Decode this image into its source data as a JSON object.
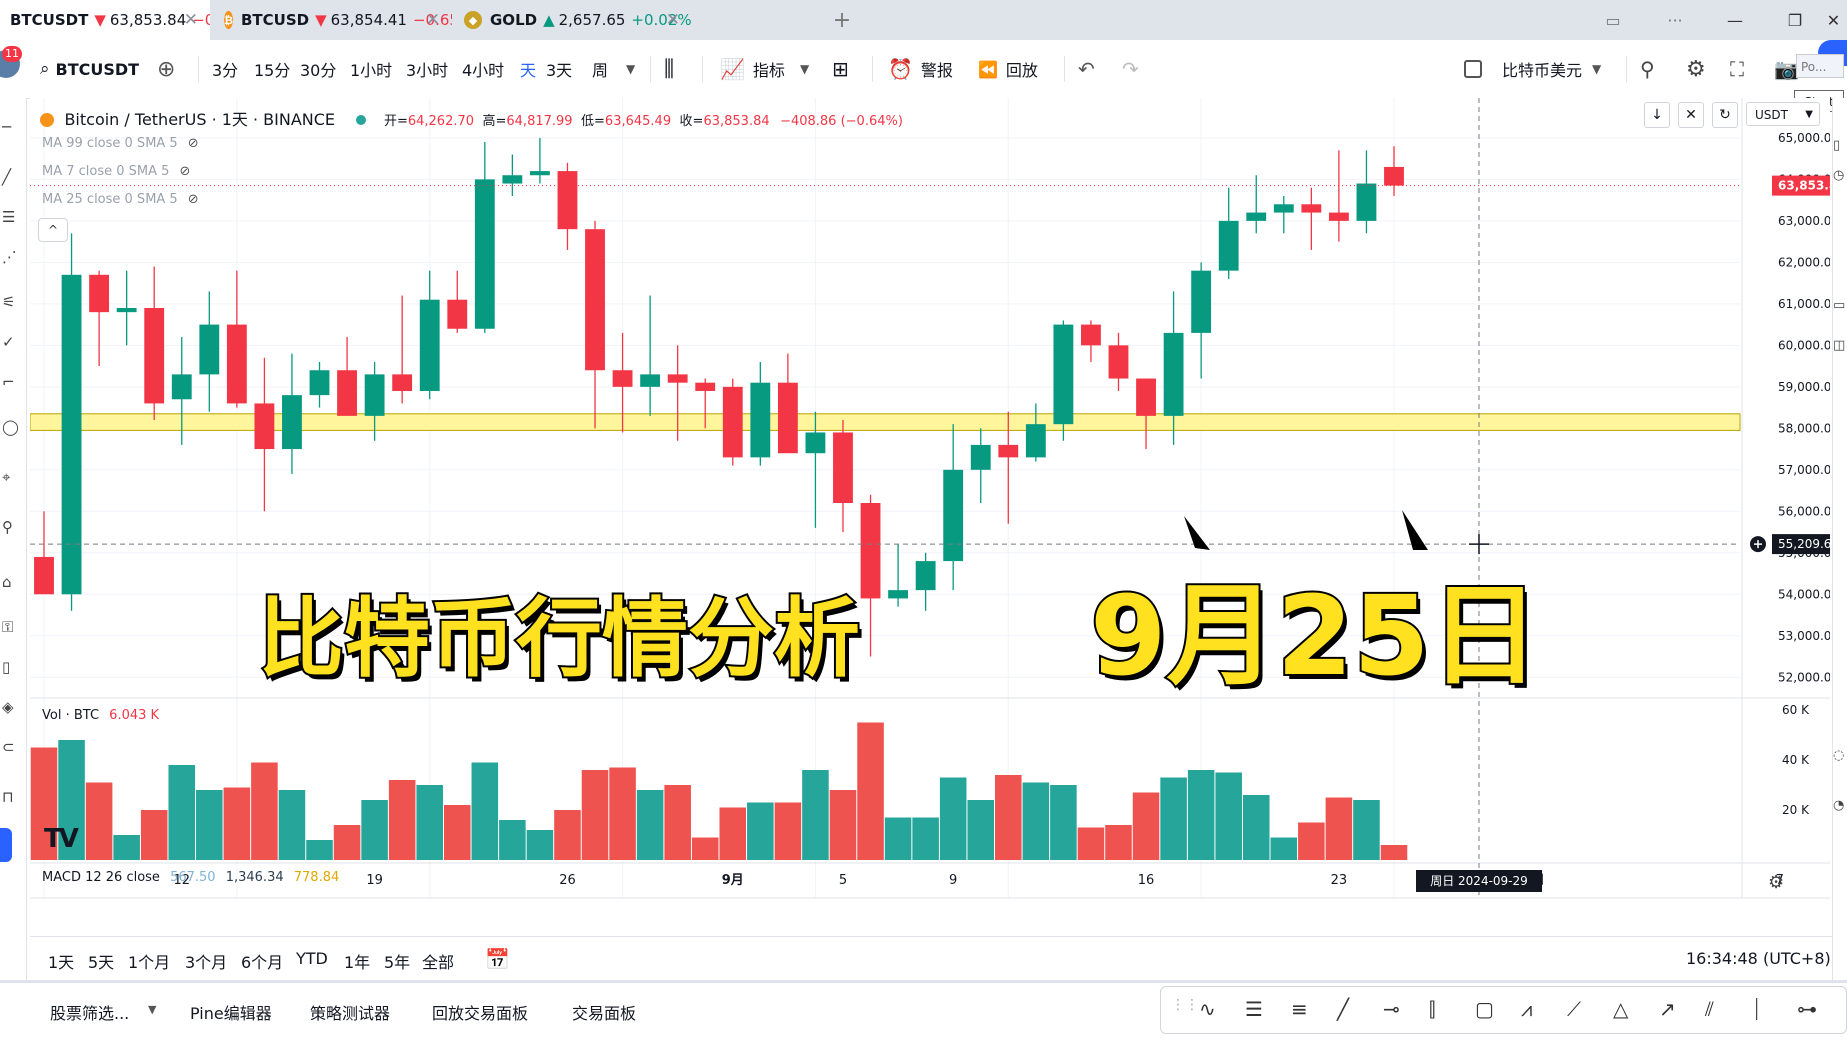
{
  "tabs": [
    {
      "symbol": "BTCUSDT",
      "arrow": "▼",
      "price": "63,853.84",
      "change": "−0.6",
      "active": true,
      "color": "#f7931a"
    },
    {
      "symbol": "BTCUSD",
      "arrow": "▼",
      "price": "63,854.41",
      "change": "−0.65",
      "active": false,
      "coin": "₿",
      "color": "#f7931a"
    },
    {
      "symbol": "GOLD",
      "arrow": "▲",
      "price": "2,657.65",
      "change": "+0.02%",
      "active": false,
      "coin": "◆",
      "color": "#c9a227"
    }
  ],
  "notification_count": "11",
  "toolbar": {
    "symbol": "BTCUSDT",
    "intervals": [
      "3分",
      "15分",
      "30分",
      "1小时",
      "3小时",
      "4小时",
      "天",
      "3天",
      "周"
    ],
    "active_interval": "天",
    "indicators_label": "指标",
    "alerts_label": "警报",
    "replay_label": "回放",
    "currency_label": "比特币美元",
    "publish_label": "Po...",
    "start_label": "Start"
  },
  "legend": {
    "title": "Bitcoin / TetherUS · 1天 · BINANCE",
    "open_label": "开=",
    "open": "64,262.70",
    "high_label": "高=",
    "high": "64,817.99",
    "low_label": "低=",
    "low": "63,645.49",
    "close_label": "收=",
    "close": "63,853.84",
    "change": "−408.86 (−0.64%)",
    "ma": [
      "MA 99 close 0 SMA 5",
      "MA 7 close 0 SMA 5",
      "MA 25 close 0 SMA 5"
    ]
  },
  "axis": {
    "unit": "USDT",
    "price_ticks": [
      "65,000.00",
      "64,000.00",
      "63,000.00",
      "62,000.00",
      "61,000.00",
      "60,000.00",
      "59,000.00",
      "58,000.00",
      "57,000.00",
      "56,000.00",
      "55,000.00",
      "54,000.00",
      "53,000.00",
      "52,000.00"
    ],
    "current_price": "63,853.84",
    "crosshair_price": "55,209.60",
    "vol_ticks": [
      "60 K",
      "40 K",
      "20 K"
    ],
    "dates": [
      "12",
      "19",
      "26",
      "9月",
      "5",
      "9",
      "16",
      "23",
      "7"
    ],
    "crosshair_date": "周日 2024-09-29",
    "hidden_date": "日"
  },
  "overlay": {
    "title": "比特币行情分析",
    "date": "9月25日"
  },
  "volume_legend": {
    "label": "Vol · BTC",
    "value": "6.043 K"
  },
  "macd_legend": {
    "label": "MACD 12 26 close",
    "v1": "567.50",
    "v2": "1,346.34",
    "v3": "778.84"
  },
  "range_buttons": [
    "1天",
    "5天",
    "1个月",
    "3个月",
    "6个月",
    "YTD",
    "1年",
    "5年",
    "全部"
  ],
  "clock": "16:34:48 (UTC+8)",
  "bottom_tabs": [
    "股票筛选...",
    "Pine编辑器",
    "策略测试器",
    "回放交易面板",
    "交易面板"
  ],
  "colors": {
    "up": "#26a69a",
    "down": "#ef5350",
    "up_body": "#089981",
    "down_body": "#f23645",
    "zone": "#fff59d"
  },
  "chart_data": {
    "type": "candlestick",
    "xlabel": "",
    "ylabel": "",
    "ylim": [
      51500,
      65600
    ],
    "support_zone": [
      57950,
      58350
    ],
    "candles": [
      {
        "o": 54900,
        "h": 56000,
        "l": 54500,
        "c": 54000
      },
      {
        "o": 54000,
        "h": 62700,
        "l": 53600,
        "c": 61700
      },
      {
        "o": 61700,
        "h": 61800,
        "l": 59500,
        "c": 60800
      },
      {
        "o": 60800,
        "h": 61800,
        "l": 60000,
        "c": 60900
      },
      {
        "o": 60900,
        "h": 61900,
        "l": 58200,
        "c": 58600
      },
      {
        "o": 58700,
        "h": 60200,
        "l": 57600,
        "c": 59300
      },
      {
        "o": 59300,
        "h": 61300,
        "l": 58400,
        "c": 60500
      },
      {
        "o": 60500,
        "h": 61800,
        "l": 58500,
        "c": 58600
      },
      {
        "o": 58600,
        "h": 59700,
        "l": 56000,
        "c": 57500
      },
      {
        "o": 57500,
        "h": 59800,
        "l": 56900,
        "c": 58800
      },
      {
        "o": 58800,
        "h": 59600,
        "l": 58500,
        "c": 59400
      },
      {
        "o": 59400,
        "h": 60200,
        "l": 58400,
        "c": 58300
      },
      {
        "o": 58300,
        "h": 59600,
        "l": 57700,
        "c": 59300
      },
      {
        "o": 59300,
        "h": 61200,
        "l": 58600,
        "c": 58900
      },
      {
        "o": 58900,
        "h": 61800,
        "l": 58700,
        "c": 61100
      },
      {
        "o": 61100,
        "h": 61800,
        "l": 60300,
        "c": 60400
      },
      {
        "o": 60400,
        "h": 64900,
        "l": 60300,
        "c": 64000
      },
      {
        "o": 63900,
        "h": 64600,
        "l": 63600,
        "c": 64100
      },
      {
        "o": 64100,
        "h": 65000,
        "l": 63900,
        "c": 64200
      },
      {
        "o": 64200,
        "h": 64400,
        "l": 62300,
        "c": 62800
      },
      {
        "o": 62800,
        "h": 63000,
        "l": 58000,
        "c": 59400
      },
      {
        "o": 59400,
        "h": 60300,
        "l": 57900,
        "c": 59000
      },
      {
        "o": 59000,
        "h": 61200,
        "l": 58300,
        "c": 59300
      },
      {
        "o": 59300,
        "h": 60000,
        "l": 57700,
        "c": 59100
      },
      {
        "o": 59100,
        "h": 59200,
        "l": 58000,
        "c": 58900
      },
      {
        "o": 59000,
        "h": 59200,
        "l": 57100,
        "c": 57300
      },
      {
        "o": 57300,
        "h": 59600,
        "l": 57100,
        "c": 59100
      },
      {
        "o": 59100,
        "h": 59800,
        "l": 57500,
        "c": 57400
      },
      {
        "o": 57400,
        "h": 58400,
        "l": 55600,
        "c": 57900
      },
      {
        "o": 57900,
        "h": 58200,
        "l": 55500,
        "c": 56200
      },
      {
        "o": 56200,
        "h": 56400,
        "l": 52500,
        "c": 53900
      },
      {
        "o": 53900,
        "h": 55200,
        "l": 53700,
        "c": 54100
      },
      {
        "o": 54100,
        "h": 55000,
        "l": 53600,
        "c": 54800
      },
      {
        "o": 54800,
        "h": 58100,
        "l": 54100,
        "c": 57000
      },
      {
        "o": 57000,
        "h": 58000,
        "l": 56200,
        "c": 57600
      },
      {
        "o": 57600,
        "h": 58400,
        "l": 55700,
        "c": 57300
      },
      {
        "o": 57300,
        "h": 58600,
        "l": 57200,
        "c": 58100
      },
      {
        "o": 58100,
        "h": 60600,
        "l": 57700,
        "c": 60500
      },
      {
        "o": 60500,
        "h": 60600,
        "l": 59600,
        "c": 60000
      },
      {
        "o": 60000,
        "h": 60300,
        "l": 58900,
        "c": 59200
      },
      {
        "o": 59200,
        "h": 59200,
        "l": 57500,
        "c": 58300
      },
      {
        "o": 58300,
        "h": 61300,
        "l": 57600,
        "c": 60300
      },
      {
        "o": 60300,
        "h": 62000,
        "l": 59200,
        "c": 61800
      },
      {
        "o": 61800,
        "h": 63800,
        "l": 61600,
        "c": 63000
      },
      {
        "o": 63000,
        "h": 64100,
        "l": 62700,
        "c": 63200
      },
      {
        "o": 63200,
        "h": 63600,
        "l": 62700,
        "c": 63400
      },
      {
        "o": 63400,
        "h": 63800,
        "l": 62300,
        "c": 63200
      },
      {
        "o": 63200,
        "h": 64700,
        "l": 62500,
        "c": 63000
      },
      {
        "o": 63000,
        "h": 64700,
        "l": 62700,
        "c": 63900
      },
      {
        "o": 64300,
        "h": 64800,
        "l": 63600,
        "c": 63850
      }
    ],
    "volume_max": 60000,
    "volumes": [
      45000,
      48000,
      31000,
      10000,
      20000,
      38000,
      28000,
      29000,
      39000,
      28000,
      8000,
      14000,
      24000,
      32000,
      30000,
      22000,
      39000,
      16000,
      12000,
      20000,
      36000,
      37000,
      28000,
      30000,
      9000,
      21000,
      23000,
      23000,
      36000,
      28000,
      55000,
      17000,
      17000,
      33000,
      24000,
      34000,
      31000,
      30000,
      13000,
      14000,
      27000,
      33000,
      36000,
      35000,
      26000,
      9000,
      15000,
      25000,
      24000,
      6000
    ]
  }
}
